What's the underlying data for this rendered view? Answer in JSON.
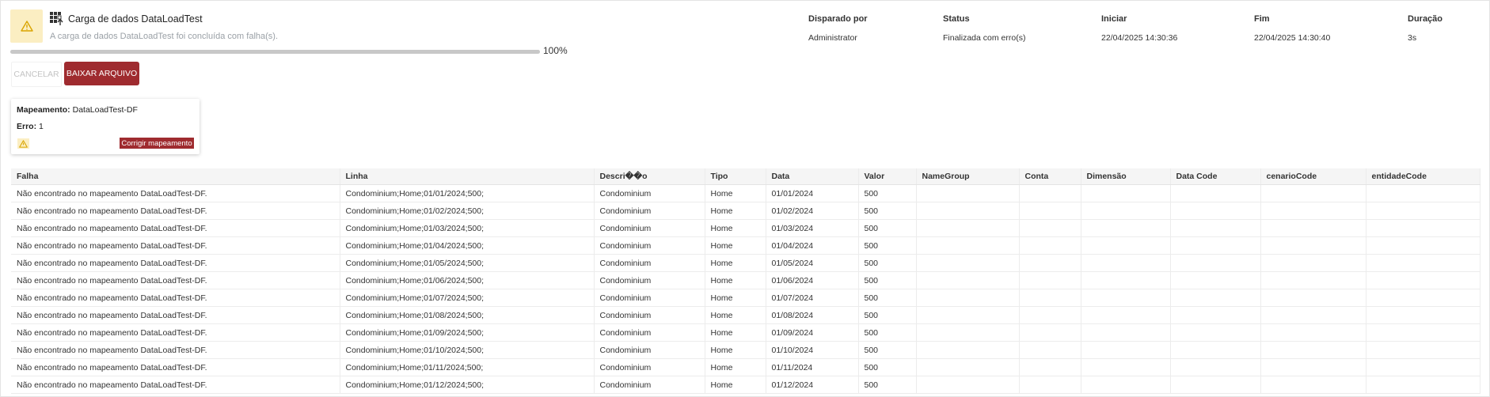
{
  "header": {
    "title": "Carga de dados DataLoadTest",
    "subtitle": "A carga de dados DataLoadTest foi concluída com falha(s).",
    "progress_label": "100%",
    "progress_value": 1.0,
    "warning_color": "#fbeec2",
    "icon_title": "data-load-icon"
  },
  "info": [
    {
      "label": "Disparado por",
      "value": "Administrator"
    },
    {
      "label": "Status",
      "value": "Finalizada com erro(s)"
    },
    {
      "label": "Iniciar",
      "value": "22/04/2025 14:30:36"
    },
    {
      "label": "Fim",
      "value": "22/04/2025 14:30:40"
    },
    {
      "label": "Duração",
      "value": "3s"
    }
  ],
  "actions": {
    "cancel_label": "CANCELAR",
    "download_label": "BAIXAR ARQUIVO",
    "accent": "#9f2b2f"
  },
  "mapping_card": {
    "mapping_label": "Mapeamento:",
    "mapping_value": "DataLoadTest-DF",
    "error_label": "Erro:",
    "error_value": "1",
    "fix_label": "Corrigir mapeamento"
  },
  "table": {
    "columns": [
      "Falha",
      "Linha",
      "Descri��o",
      "Tipo",
      "Data",
      "Valor",
      "NameGroup",
      "Conta",
      "Dimensão",
      "Data Code",
      "cenarioCode",
      "entidadeCode"
    ],
    "rows": [
      [
        "Não encontrado no mapeamento DataLoadTest-DF.",
        "Condominium;Home;01/01/2024;500;",
        "Condominium",
        "Home",
        "01/01/2024",
        "500",
        "",
        "",
        "",
        "",
        "",
        ""
      ],
      [
        "Não encontrado no mapeamento DataLoadTest-DF.",
        "Condominium;Home;01/02/2024;500;",
        "Condominium",
        "Home",
        "01/02/2024",
        "500",
        "",
        "",
        "",
        "",
        "",
        ""
      ],
      [
        "Não encontrado no mapeamento DataLoadTest-DF.",
        "Condominium;Home;01/03/2024;500;",
        "Condominium",
        "Home",
        "01/03/2024",
        "500",
        "",
        "",
        "",
        "",
        "",
        ""
      ],
      [
        "Não encontrado no mapeamento DataLoadTest-DF.",
        "Condominium;Home;01/04/2024;500;",
        "Condominium",
        "Home",
        "01/04/2024",
        "500",
        "",
        "",
        "",
        "",
        "",
        ""
      ],
      [
        "Não encontrado no mapeamento DataLoadTest-DF.",
        "Condominium;Home;01/05/2024;500;",
        "Condominium",
        "Home",
        "01/05/2024",
        "500",
        "",
        "",
        "",
        "",
        "",
        ""
      ],
      [
        "Não encontrado no mapeamento DataLoadTest-DF.",
        "Condominium;Home;01/06/2024;500;",
        "Condominium",
        "Home",
        "01/06/2024",
        "500",
        "",
        "",
        "",
        "",
        "",
        ""
      ],
      [
        "Não encontrado no mapeamento DataLoadTest-DF.",
        "Condominium;Home;01/07/2024;500;",
        "Condominium",
        "Home",
        "01/07/2024",
        "500",
        "",
        "",
        "",
        "",
        "",
        ""
      ],
      [
        "Não encontrado no mapeamento DataLoadTest-DF.",
        "Condominium;Home;01/08/2024;500;",
        "Condominium",
        "Home",
        "01/08/2024",
        "500",
        "",
        "",
        "",
        "",
        "",
        ""
      ],
      [
        "Não encontrado no mapeamento DataLoadTest-DF.",
        "Condominium;Home;01/09/2024;500;",
        "Condominium",
        "Home",
        "01/09/2024",
        "500",
        "",
        "",
        "",
        "",
        "",
        ""
      ],
      [
        "Não encontrado no mapeamento DataLoadTest-DF.",
        "Condominium;Home;01/10/2024;500;",
        "Condominium",
        "Home",
        "01/10/2024",
        "500",
        "",
        "",
        "",
        "",
        "",
        ""
      ],
      [
        "Não encontrado no mapeamento DataLoadTest-DF.",
        "Condominium;Home;01/11/2024;500;",
        "Condominium",
        "Home",
        "01/11/2024",
        "500",
        "",
        "",
        "",
        "",
        "",
        ""
      ],
      [
        "Não encontrado no mapeamento DataLoadTest-DF.",
        "Condominium;Home;01/12/2024;500;",
        "Condominium",
        "Home",
        "01/12/2024",
        "500",
        "",
        "",
        "",
        "",
        "",
        ""
      ]
    ]
  }
}
